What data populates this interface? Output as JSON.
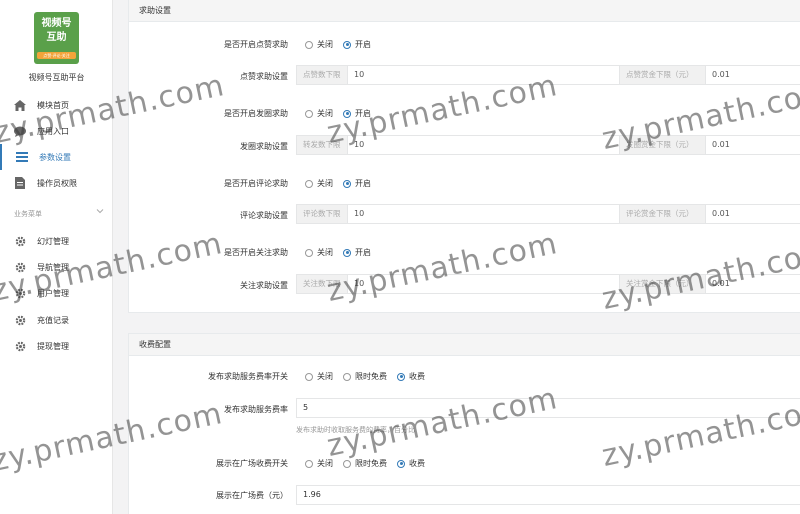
{
  "sidebar": {
    "logo": {
      "line1": "视频号",
      "line2": "互助",
      "tag": "点赞·评论·关注"
    },
    "platform_name": "视频号互助平台",
    "items": [
      {
        "label": "模块首页",
        "icon": "home-icon"
      },
      {
        "label": "应用入口",
        "icon": "chat-icon"
      },
      {
        "label": "参数设置",
        "icon": "list-icon",
        "active": true
      },
      {
        "label": "操作员权限",
        "icon": "document-icon"
      }
    ],
    "section_label": "业务菜单",
    "business_items": [
      {
        "label": "幻灯管理",
        "icon": "gear-icon"
      },
      {
        "label": "导航管理",
        "icon": "gear-icon"
      },
      {
        "label": "用户管理",
        "icon": "gear-icon"
      },
      {
        "label": "充值记录",
        "icon": "gear-icon"
      },
      {
        "label": "提现管理",
        "icon": "gear-icon"
      }
    ]
  },
  "help_panel": {
    "title": "求助设置",
    "rows": [
      {
        "type": "radio",
        "label": "是否开启点赞求助",
        "options": [
          "关闭",
          "开启"
        ],
        "selected": 1
      },
      {
        "type": "input",
        "label": "点赞求助设置",
        "addon1": "点赞数下限",
        "value1": "10",
        "addon2": "点赞赏金下限（元）",
        "value2": "0.01"
      },
      {
        "type": "radio",
        "label": "是否开启发圈求助",
        "options": [
          "关闭",
          "开启"
        ],
        "selected": 1
      },
      {
        "type": "input",
        "label": "发圈求助设置",
        "addon1": "转发数下限",
        "value1": "10",
        "addon2": "发圈赏金下限（元）",
        "value2": "0.01"
      },
      {
        "type": "radio",
        "label": "是否开启评论求助",
        "options": [
          "关闭",
          "开启"
        ],
        "selected": 1
      },
      {
        "type": "input",
        "label": "评论求助设置",
        "addon1": "评论数下限",
        "value1": "10",
        "addon2": "评论赏金下限（元）",
        "value2": "0.01"
      },
      {
        "type": "radio",
        "label": "是否开启关注求助",
        "options": [
          "关闭",
          "开启"
        ],
        "selected": 1
      },
      {
        "type": "input",
        "label": "关注求助设置",
        "addon1": "关注数下限",
        "value1": "10",
        "addon2": "关注赏金下限（元）",
        "value2": "0.01"
      }
    ]
  },
  "fee_panel": {
    "title": "收费配置",
    "fee_switch": {
      "label": "发布求助服务费率开关",
      "options": [
        "关闭",
        "限时免费",
        "收费"
      ],
      "selected": 2
    },
    "fee_rate": {
      "label": "发布求助服务费率",
      "value": "5",
      "help": "发布求助时收取服务费的费率，百分比"
    },
    "square_switch": {
      "label": "展示在广场收费开关",
      "options": [
        "关闭",
        "限时免费",
        "收费"
      ],
      "selected": 2
    },
    "square_fee": {
      "label": "展示在广场费（元）",
      "value": "1.96"
    }
  },
  "watermark": "zy.prmath.com",
  "colors": {
    "primary": "#337ab7",
    "logo_green": "#5aa04a",
    "logo_orange": "#f3a43a"
  }
}
